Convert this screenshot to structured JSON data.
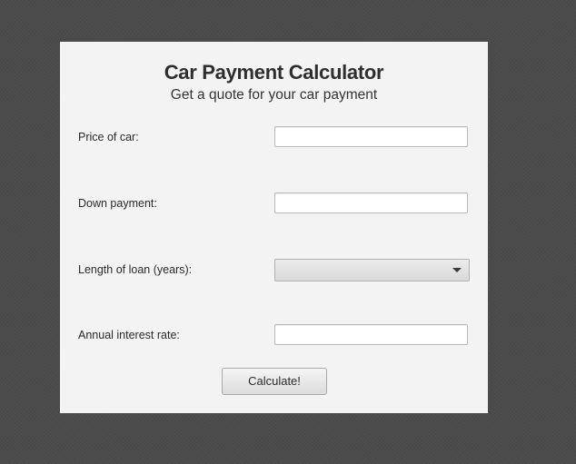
{
  "form": {
    "title": "Car Payment Calculator",
    "subtitle": "Get a quote for your car payment",
    "price": {
      "label": "Price of car:",
      "value": ""
    },
    "down_payment": {
      "label": "Down payment:",
      "value": ""
    },
    "loan_length": {
      "label": "Length of loan (years):",
      "selected": ""
    },
    "interest_rate": {
      "label": "Annual interest rate:",
      "value": ""
    },
    "calculate_label": "Calculate!"
  },
  "colors": {
    "background": "#4b4b4b",
    "panel": "#f3f3f3",
    "title_text": "#2e2e2e"
  },
  "icons": {
    "dropdown": "chevron-down-icon"
  }
}
